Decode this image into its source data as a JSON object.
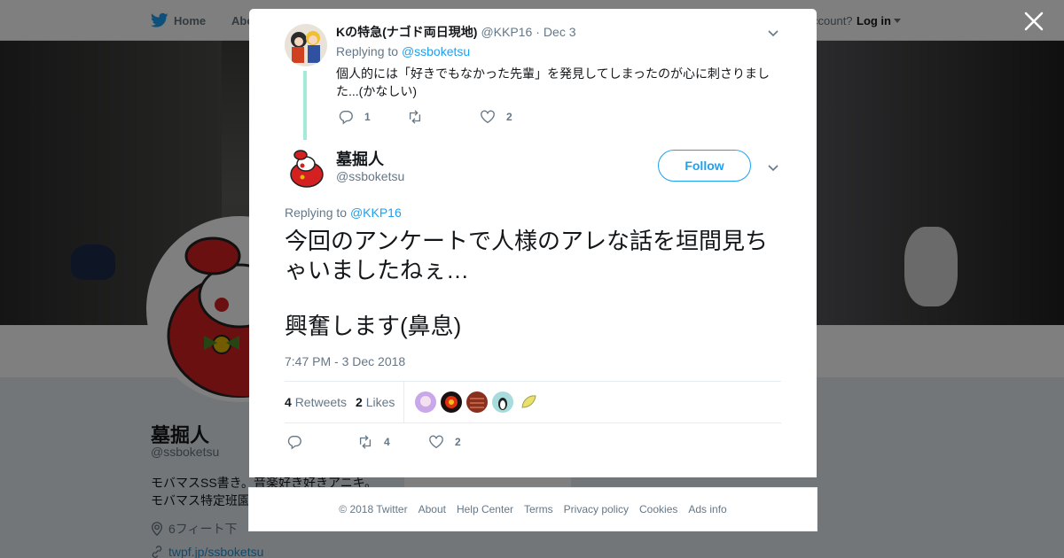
{
  "nav": {
    "home_label": "Home",
    "about_label": "Abo",
    "account_prompt": "ccount?",
    "login_label": "Log in"
  },
  "profile": {
    "name": "墓掘人",
    "handle": "@ssboketsu",
    "bio_line1": "モバマスSS書き。音楽好き好きアニキ。",
    "bio_line2": "モバマス特定班園",
    "location": "6フィート下",
    "url": "twpf.jp/ssboketsu"
  },
  "parent_tweet": {
    "name": "Kの特急(ナゴド両日現地)",
    "handle": "@KKP16",
    "separator": "·",
    "date": "Dec 3",
    "replying_prefix": "Replying to",
    "replying_to": "@ssboketsu",
    "text": "個人的には「好きでもなかった先輩」を発見してしまったのが心に刺さりました...(かなしい)",
    "reply_count": "1",
    "retweet_count": "",
    "like_count": "2"
  },
  "main_tweet": {
    "name": "墓掘人",
    "handle": "@ssboketsu",
    "follow_label": "Follow",
    "replying_prefix": "Replying to",
    "replying_to": "@KKP16",
    "text_line1": "今回のアンケートで人様のアレな話を垣間見ちゃいましたねぇ…",
    "text_line2": "興奮します(鼻息)",
    "timestamp": "7:47 PM - 3 Dec 2018",
    "retweets_count": "4",
    "retweets_label": "Retweets",
    "likes_count": "2",
    "likes_label": "Likes",
    "reply_count": "",
    "retweet_count": "4",
    "like_count": "2"
  },
  "footer": {
    "copyright": "© 2018 Twitter",
    "links": [
      "About",
      "Help Center",
      "Terms",
      "Privacy policy",
      "Cookies",
      "Ads info"
    ]
  },
  "colors": {
    "accent": "#1da1f2",
    "thread_line": "#a3ebd6",
    "muted": "#657786"
  },
  "icons": [
    "twitter-bird-icon",
    "close-icon",
    "chevron-down-icon",
    "reply-icon",
    "retweet-icon",
    "heart-icon",
    "location-icon",
    "link-icon"
  ]
}
